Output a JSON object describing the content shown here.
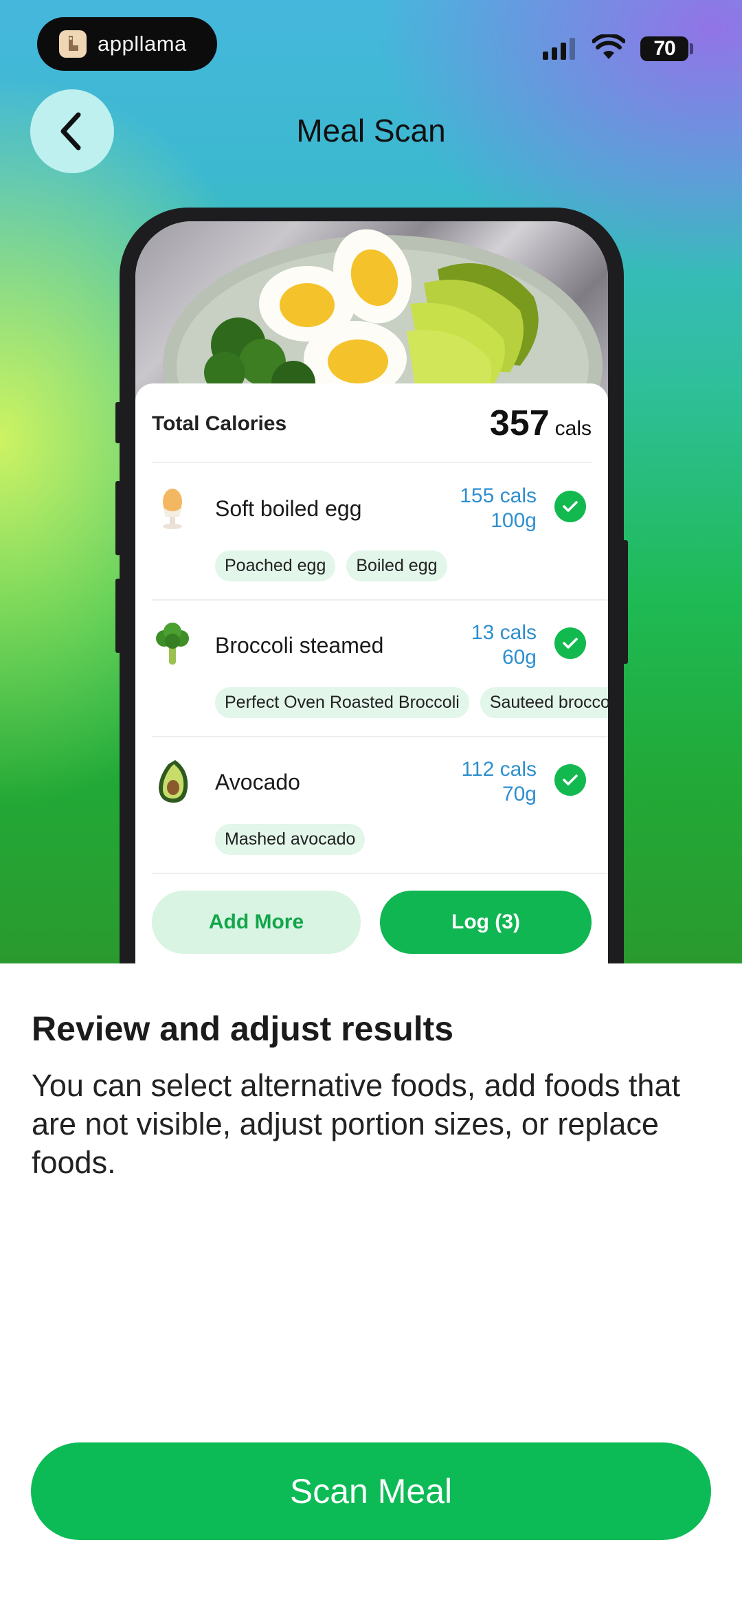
{
  "status_bar": {
    "brand": "appllama",
    "battery": "70"
  },
  "header": {
    "title": "Meal Scan",
    "back_icon": "chevron-left-icon"
  },
  "meal_card": {
    "total_label": "Total Calories",
    "total_value": "357",
    "total_unit": "cals",
    "items": [
      {
        "icon": "egg-icon",
        "name": "Soft boiled egg",
        "cals": "155 cals",
        "weight": "100g",
        "checked": true,
        "alternatives": [
          "Poached egg",
          "Boiled egg"
        ]
      },
      {
        "icon": "broccoli-icon",
        "name": "Broccoli steamed",
        "cals": "13 cals",
        "weight": "60g",
        "checked": true,
        "alternatives": [
          "Perfect Oven Roasted Broccoli",
          "Sauteed broccoli"
        ]
      },
      {
        "icon": "avocado-icon",
        "name": "Avocado",
        "cals": "112 cals",
        "weight": "70g",
        "checked": true,
        "alternatives": [
          "Mashed avocado"
        ]
      }
    ],
    "add_more_label": "Add More",
    "log_label": "Log (3)"
  },
  "content": {
    "heading": "Review and adjust results",
    "description": "You can select alternative foods, add foods that are not visible, adjust portion sizes, or replace foods."
  },
  "cta": {
    "label": "Scan Meal"
  },
  "colors": {
    "accent_green": "#0cbb55",
    "cal_blue": "#2f8fcf",
    "chip_bg": "#e2f6ea"
  }
}
